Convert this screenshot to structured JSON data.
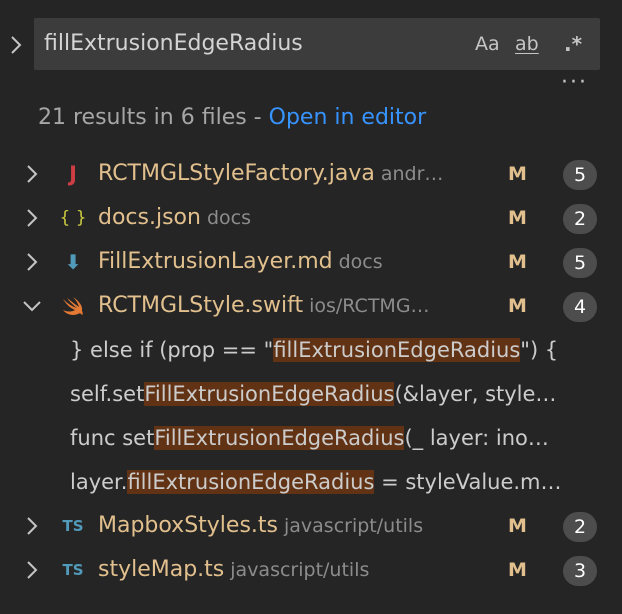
{
  "search": {
    "query": "fillExtrusionEdgeRadius",
    "match_case_label": "Aa",
    "whole_word_label": "ab",
    "regex_label": ".*"
  },
  "summary": {
    "text": "21 results in 6 files - ",
    "link": "Open in editor"
  },
  "results": [
    {
      "name": "RCTMGLStyleFactory.java",
      "path": "andr…",
      "status": "M",
      "count": "5",
      "icon": "java-icon",
      "icon_glyph": "J",
      "icon_color": "#cc3e44",
      "expanded": false
    },
    {
      "name": "docs.json",
      "path": "docs",
      "status": "M",
      "count": "2",
      "icon": "json-icon",
      "icon_glyph": "{ }",
      "icon_color": "#cbcb41",
      "expanded": false
    },
    {
      "name": "FillExtrusionLayer.md",
      "path": "docs",
      "status": "M",
      "count": "5",
      "icon": "markdown-icon",
      "icon_glyph": "⬇",
      "icon_color": "#519aba",
      "expanded": false
    },
    {
      "name": "RCTMGLStyle.swift",
      "path": "ios/RCTMG…",
      "status": "M",
      "count": "4",
      "icon": "swift-icon",
      "icon_glyph": "",
      "icon_color": "#e37933",
      "expanded": true
    },
    {
      "name": "MapboxStyles.ts",
      "path": "javascript/utils",
      "status": "M",
      "count": "2",
      "icon": "typescript-icon",
      "icon_glyph": "TS",
      "icon_color": "#519aba",
      "expanded": false
    },
    {
      "name": "styleMap.ts",
      "path": "javascript/utils",
      "status": "M",
      "count": "3",
      "icon": "typescript-icon",
      "icon_glyph": "TS",
      "icon_color": "#519aba",
      "expanded": false
    }
  ],
  "matches": [
    {
      "before": "} else if (prop == \"",
      "highlight": "fillExtrusionEdgeRadius",
      "after": "\") {"
    },
    {
      "before": "self.set",
      "highlight": "FillExtrusionEdgeRadius",
      "after": "(&layer, style…"
    },
    {
      "before": "func set",
      "highlight": "FillExtrusionEdgeRadius",
      "after": "(_ layer: ino…"
    },
    {
      "before": "layer.",
      "highlight": "fillExtrusionEdgeRadius",
      "after": " = styleValue.m…"
    }
  ],
  "colors": {
    "background": "#252526",
    "input_background": "#3c3c3c",
    "link": "#3794ff",
    "modified": "#e2c08d",
    "match_highlight": "#613214",
    "badge": "#4d4d4d"
  }
}
